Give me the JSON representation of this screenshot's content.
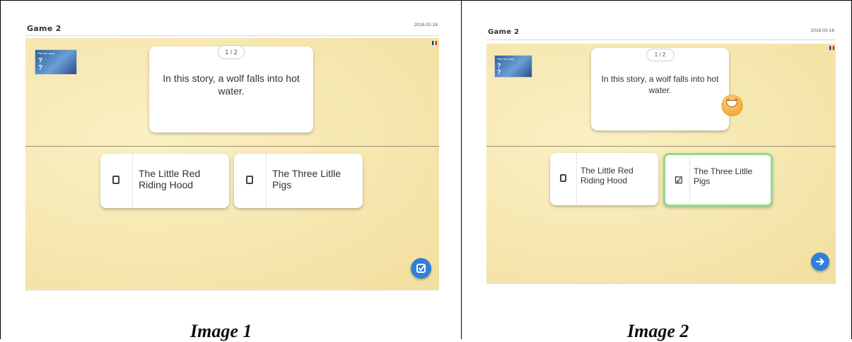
{
  "images": [
    {
      "game_title": "Game 2",
      "date": "2018-02-18",
      "counter": "1 / 2",
      "question": "In this story, a wolf falls into hot water.",
      "thumbnail_caption": "Pick the story",
      "options": [
        {
          "label": "The Little Red Riding Hood",
          "checked": false
        },
        {
          "label": "The Three Litlle Pigs",
          "checked": false
        }
      ],
      "fab_icon": "check-icon",
      "caption": "Image 1"
    },
    {
      "game_title": "Game 2",
      "date": "2018-02-18",
      "counter": "1 / 2",
      "question": "In this story, a wolf falls into hot water.",
      "thumbnail_caption": "Pick the story",
      "options": [
        {
          "label": "The Little Red Riding Hood",
          "checked": false
        },
        {
          "label": "The Three Litlle Pigs",
          "checked": true
        }
      ],
      "fab_icon": "arrow-right-icon",
      "feedback_icon": "happy-face-icon",
      "caption": "Image 2"
    }
  ],
  "colors": {
    "board": "#f6e7b0",
    "accent_blue": "#2f80d9",
    "selected_border": "#8fdc8a"
  }
}
